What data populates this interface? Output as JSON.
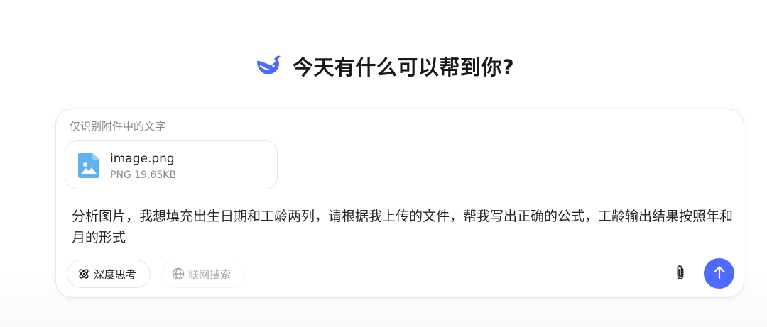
{
  "header": {
    "logo_icon": "whale-logo-icon",
    "title": "今天有什么可以帮到你?"
  },
  "composer": {
    "ocr_hint": "仅识别附件中的文字",
    "attachment": {
      "icon": "image-file-icon",
      "name": "image.png",
      "meta": "PNG 19.65KB"
    },
    "input_text": "分析图片，我想填充出生日期和工龄两列，请根据我上传的文件，帮我写出正确的公式，工龄输出结果按照年和月的形式",
    "buttons": {
      "deep_think": "深度思考",
      "web_search": "联网搜索",
      "attach_icon": "paperclip-icon",
      "send_icon": "arrow-up-icon"
    }
  },
  "colors": {
    "brand": "#4d6bfe",
    "text": "#262626",
    "muted": "#8a8a8a",
    "disabled": "#a3a3a3"
  }
}
